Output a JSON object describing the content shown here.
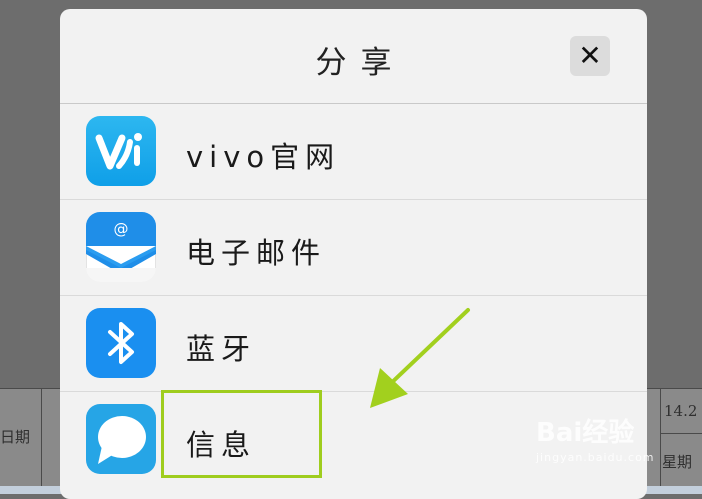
{
  "share_sheet": {
    "title": "分享",
    "close_label": "✕",
    "items": [
      {
        "label": "vivo官网",
        "icon": "vivo-logo-icon"
      },
      {
        "label": "电子邮件",
        "icon": "email-envelope-icon"
      },
      {
        "label": "蓝牙",
        "icon": "bluetooth-icon"
      },
      {
        "label": "信息",
        "icon": "message-bubble-icon"
      }
    ]
  },
  "background_document": {
    "left_cell_text": "日期",
    "right_cell_text_top": "14.2",
    "right_cell_text_bottom": "星期"
  },
  "watermark": {
    "brand": "Bai经验",
    "url": "jingyan.baidu.com"
  },
  "colors": {
    "overlay": "#6d6d6d",
    "sheet_bg": "#f2f2f2",
    "highlight": "#9fcd1e",
    "vivo_blue": "#1aa8ee",
    "bluetooth_blue": "#1a8ff0",
    "message_blue": "#26a5e6"
  }
}
